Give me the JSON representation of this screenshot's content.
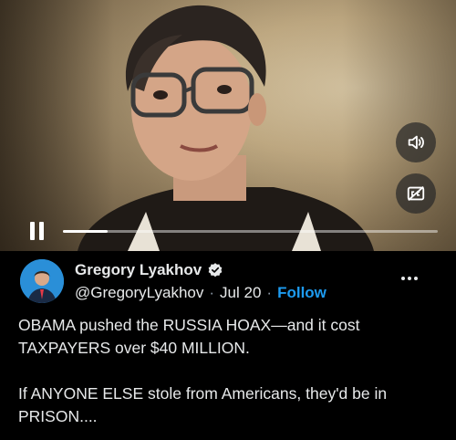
{
  "video": {
    "progress": 0.12,
    "controls": {
      "volume_icon": "speaker-icon",
      "captions_icon": "captions-off-icon",
      "pause_icon": "pause-icon"
    }
  },
  "tweet": {
    "author_name": "Gregory Lyakhov",
    "handle": "@GregoryLyakhov",
    "separator": "·",
    "date": "Jul 20",
    "follow_label": "Follow",
    "verified_color": "#e7e9ea",
    "accent_color": "#1d9bf0",
    "text": "OBAMA pushed the RUSSIA HOAX—and it cost TAXPAYERS over $40 MILLION.\n\nIf ANYONE ELSE stole from Americans, they'd be in PRISON...."
  }
}
